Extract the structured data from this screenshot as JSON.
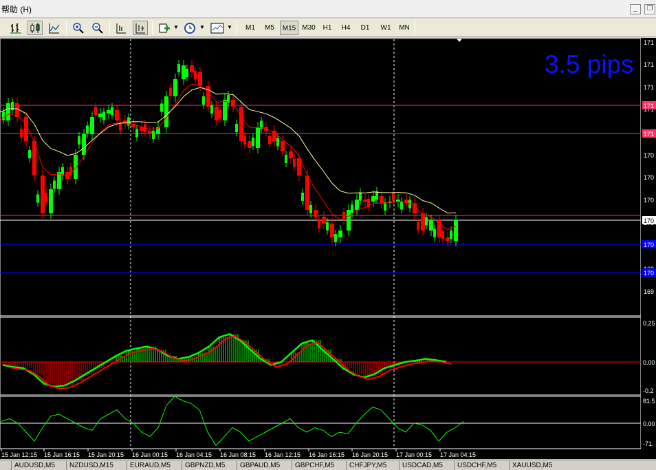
{
  "menu": {
    "help": "帮助 (H)"
  },
  "toolbar": {
    "icons": [
      "bar-chart-icon",
      "candlestick-icon",
      "line-chart-icon",
      "zoom-in-icon",
      "zoom-out-icon",
      "chart-shift-icon",
      "autoscroll-icon",
      "indicators-icon",
      "periods-icon",
      "templates-icon"
    ],
    "timeframes": [
      "M1",
      "M5",
      "M15",
      "M30",
      "H1",
      "H4",
      "D1",
      "W1",
      "MN"
    ],
    "active_timeframe": "M15"
  },
  "chart": {
    "pips_label": "3.5 pips",
    "price_axis_labels": [
      "171",
      "171",
      "171",
      "171",
      "171",
      "170",
      "170",
      "170",
      "170",
      "170",
      "169",
      "169"
    ],
    "horizontal_line_tags": [
      "171",
      "171",
      "170",
      "170",
      "170"
    ],
    "macd_axis": [
      "0.25",
      "0.00",
      "-0.2"
    ],
    "osc_axis": [
      "81.5",
      "0.00",
      "-71."
    ],
    "time_labels": [
      "15 Jan 12:15",
      "15 Jan 16:15",
      "15 Jan 20:15",
      "16 Jan 00:15",
      "16 Jan 04:15",
      "16 Jan 08:15",
      "16 Jan 12:15",
      "16 Jan 16:15",
      "16 Jan 20:15",
      "17 Jan 00:15",
      "17 Jan 04:15"
    ],
    "colors": {
      "bull": "#00ff00",
      "bear": "#ff0000",
      "ma_fast": "#ff0000",
      "ma_slow": "#ffff99",
      "hline_red": "#ff3366",
      "hline_blue": "#0000ff",
      "hline_white": "#ffffff",
      "grid": "#ffffff"
    }
  },
  "symbol_tabs": [
    "AUDUSD,M5",
    "NZDUSD,M15",
    "EURAUD,M5",
    "GBPNZD,M5",
    "GBPAUD,M5",
    "GBPCHF,M5",
    "CHFJPY,M5",
    "USDCAD,M5",
    "USDCHF,M5",
    "XAUUSD,M5"
  ]
}
